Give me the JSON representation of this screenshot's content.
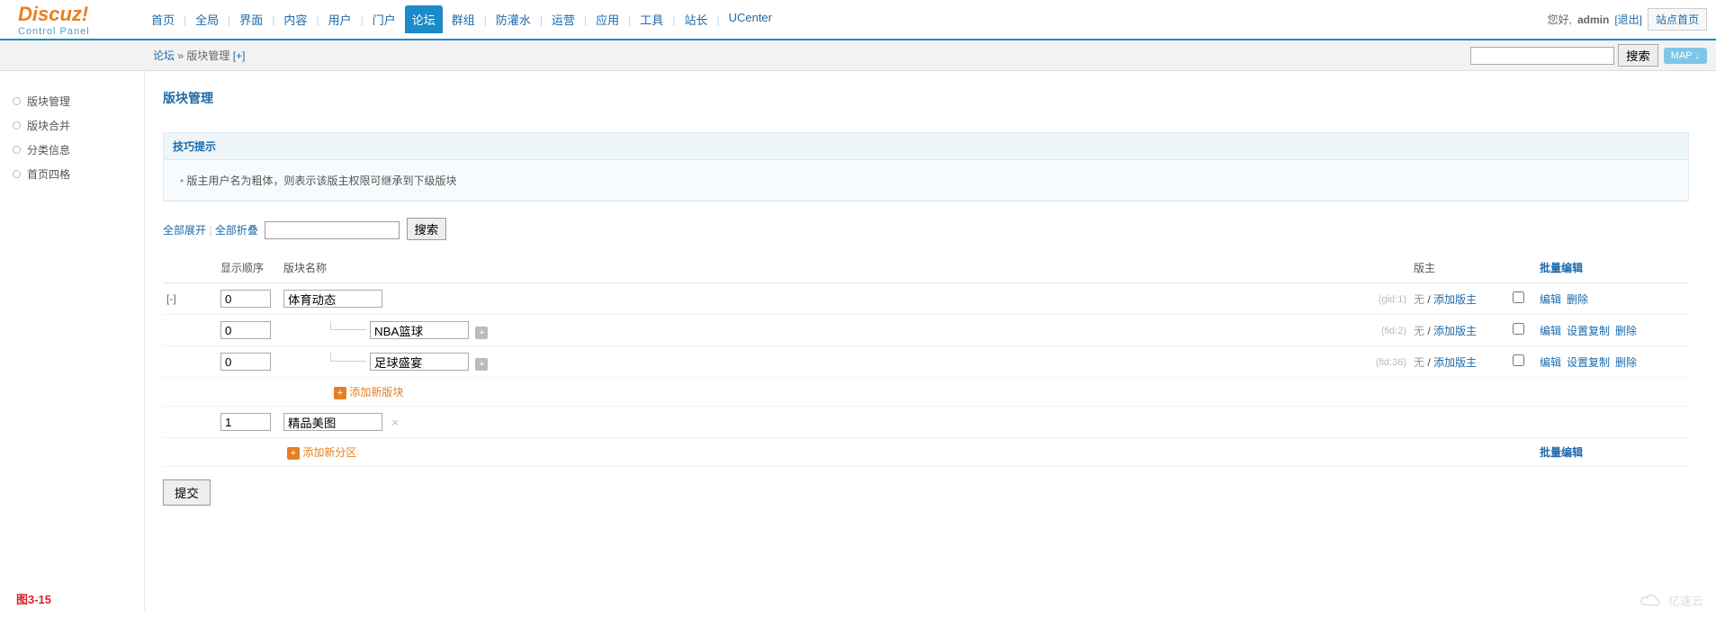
{
  "header": {
    "brand1": "Discuz",
    "brand2": "!",
    "cp": "Control Panel",
    "nav": [
      "首页",
      "全局",
      "界面",
      "内容",
      "用户",
      "门户",
      "论坛",
      "群组",
      "防灌水",
      "运营",
      "应用",
      "工具",
      "站长",
      "UCenter"
    ],
    "active_index": 6,
    "greeting": "您好,",
    "username": "admin",
    "logout": "[退出]",
    "site_home": "站点首页"
  },
  "subbar": {
    "crumb1": "论坛",
    "sep": "»",
    "crumb2": "版块管理",
    "plus": "[+]",
    "search_btn": "搜索",
    "map": "MAP ↓"
  },
  "sidebar": {
    "items": [
      "版块管理",
      "版块合并",
      "分类信息",
      "首页四格"
    ]
  },
  "page": {
    "title": "版块管理",
    "tip_head": "技巧提示",
    "tip_text": "版主用户名为粗体，则表示该版主权限可继承到下级版块",
    "expand_all": "全部展开",
    "collapse_all": "全部折叠",
    "search_btn": "搜索",
    "col_order": "显示顺序",
    "col_name": "版块名称",
    "col_owner": "版主",
    "col_batch": "批量编辑",
    "toggle": "[-]",
    "none": "无",
    "add_owner": "添加版主",
    "edit": "编辑",
    "delete": "删除",
    "copy_setting": "设置复制",
    "add_sub": "添加新版块",
    "add_cat": "添加新分区",
    "batch_edit": "批量编辑",
    "submit": "提交"
  },
  "rows": [
    {
      "order": "0",
      "name": "体育动态",
      "id": "(gid:1)",
      "level": 0,
      "plus": false,
      "ops": [
        "edit",
        "delete"
      ]
    },
    {
      "order": "0",
      "name": "NBA篮球",
      "id": "(fid:2)",
      "level": 1,
      "plus": true,
      "ops": [
        "edit",
        "copy",
        "delete"
      ]
    },
    {
      "order": "0",
      "name": "足球盛宴",
      "id": "(fid:36)",
      "level": 1,
      "plus": true,
      "ops": [
        "edit",
        "copy",
        "delete"
      ]
    }
  ],
  "newrow": {
    "order": "1",
    "name": "精品美图"
  },
  "footer": {
    "figure": "图3-15",
    "cloud": "亿速云"
  }
}
